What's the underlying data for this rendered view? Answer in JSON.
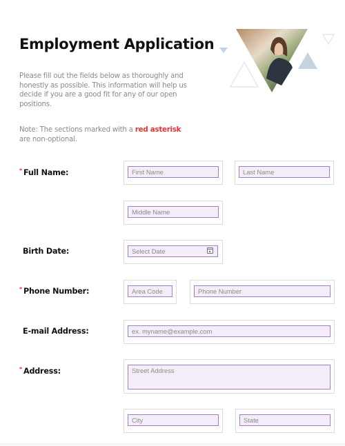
{
  "form": {
    "title": "Employment Application",
    "intro": "Please fill out the fields below as thoroughly and honestly as possible. This information will help us decide if you are a good fit for any of our open positions.",
    "note_prefix": "Note: The sections marked with a ",
    "note_highlight": "red asterisk",
    "note_suffix": " are non-optional.",
    "required_marker": "*",
    "accent_color": "#e8312f",
    "field_border_color": "#a27bc9",
    "field_bg_color": "#f3edf8",
    "hero_image": "woman-shaking-hands-triangle-image"
  },
  "fields": {
    "full_name": {
      "label": "Full Name:",
      "required": true,
      "first_placeholder": "First Name",
      "last_placeholder": "Last Name",
      "middle_placeholder": "Middle Name"
    },
    "birth_date": {
      "label": "Birth Date:",
      "required": false,
      "placeholder": "Select Date",
      "icon": "calendar-icon"
    },
    "phone": {
      "label": "Phone Number:",
      "required": true,
      "area_placeholder": "Area Code",
      "number_placeholder": "Phone Number"
    },
    "email": {
      "label": "E-mail Address:",
      "required": false,
      "placeholder": "ex. myname@example.com"
    },
    "address": {
      "label": "Address:",
      "required": true,
      "street_placeholder": "Street Address",
      "city_placeholder": "City",
      "state_placeholder": "State"
    }
  }
}
